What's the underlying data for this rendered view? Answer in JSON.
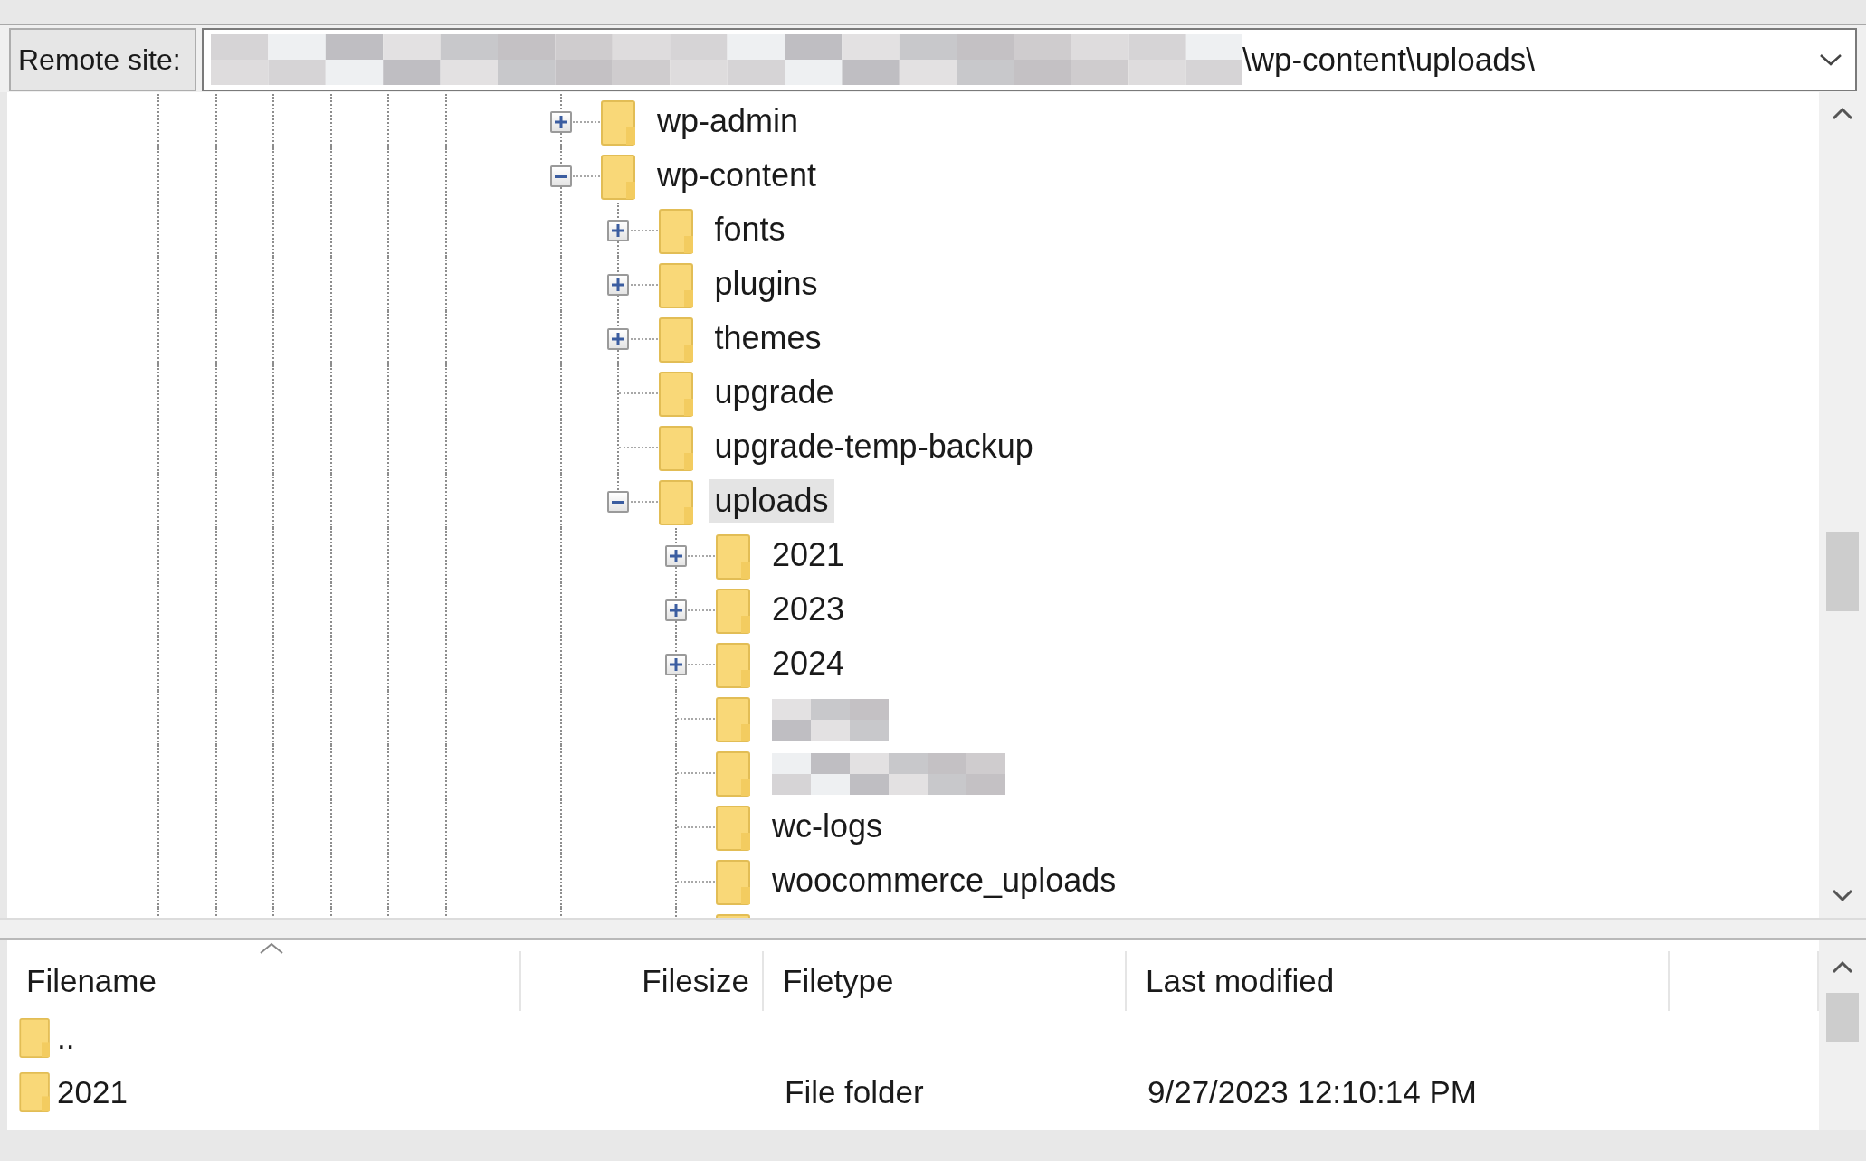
{
  "remote_site": {
    "label": "Remote site:",
    "path": "\\wp-content\\uploads\\"
  },
  "tree": [
    {
      "label": "wp-admin",
      "kind": "branch",
      "expanded": false,
      "selected": false
    },
    {
      "label": "wp-content",
      "kind": "branch",
      "expanded": true,
      "selected": false,
      "children": [
        {
          "label": "fonts",
          "kind": "branch",
          "expanded": false,
          "selected": false
        },
        {
          "label": "plugins",
          "kind": "branch",
          "expanded": false,
          "selected": false
        },
        {
          "label": "themes",
          "kind": "branch",
          "expanded": false,
          "selected": false
        },
        {
          "label": "upgrade",
          "kind": "leaf",
          "selected": false
        },
        {
          "label": "upgrade-temp-backup",
          "kind": "leaf",
          "selected": false
        },
        {
          "label": "uploads",
          "kind": "branch",
          "expanded": true,
          "selected": true,
          "children": [
            {
              "label": "2021",
              "kind": "branch",
              "expanded": false,
              "selected": false
            },
            {
              "label": "2023",
              "kind": "branch",
              "expanded": false,
              "selected": false
            },
            {
              "label": "2024",
              "kind": "branch",
              "expanded": false,
              "selected": false
            },
            {
              "kind": "redacted"
            },
            {
              "kind": "redacted"
            },
            {
              "label": "wc-logs",
              "kind": "leaf",
              "selected": false
            },
            {
              "label": "woocommerce_uploads",
              "kind": "leaf",
              "selected": false
            },
            {
              "kind": "partial"
            }
          ]
        }
      ]
    }
  ],
  "file_list": {
    "columns": [
      {
        "label": "Filename",
        "sorted": true
      },
      {
        "label": "Filesize",
        "sorted": false
      },
      {
        "label": "Filetype",
        "sorted": false
      },
      {
        "label": "Last modified",
        "sorted": false
      }
    ],
    "rows": [
      {
        "name": ".."
      },
      {
        "name": "2021",
        "filetype": "File folder",
        "last_modified": "9/27/2023 12:10:14 PM"
      }
    ]
  }
}
